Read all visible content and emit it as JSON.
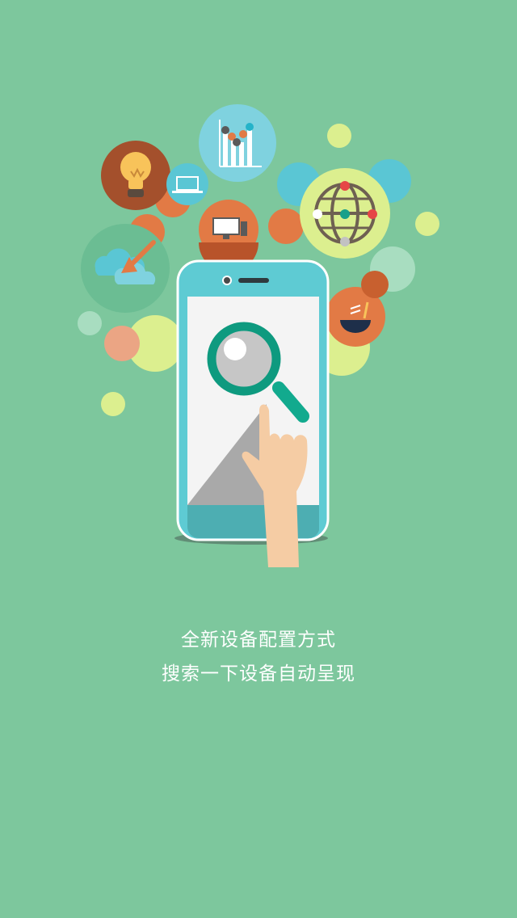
{
  "intro": {
    "line1": "全新设备配置方式",
    "line2": "搜索一下设备自动呈现"
  },
  "colors": {
    "background": "#7dc79d",
    "phone_body": "#5ecbd3",
    "phone_screen": "#f4f4f4",
    "magnifier_ring": "#0e9a7f",
    "hand": "#f5cca4",
    "orange": "#e27a45",
    "lime": "#dcef8f",
    "teal": "#5ac6d4"
  },
  "icons": [
    "lightbulb-icon",
    "laptop-icon",
    "bar-chart-icon",
    "desktop-computer-icon",
    "globe-network-icon",
    "cloud-icon",
    "bowl-icon",
    "magnifier-icon",
    "pointing-hand-icon"
  ]
}
